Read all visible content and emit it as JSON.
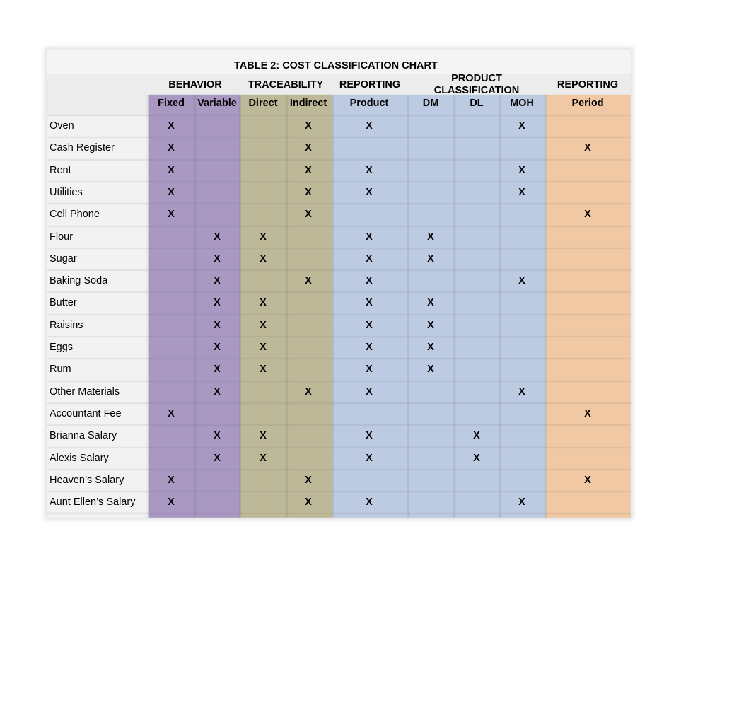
{
  "title": "TABLE 2:  COST CLASSIFICATION CHART",
  "groups": {
    "behavior": "BEHAVIOR",
    "traceability": "TRACEABILITY",
    "reporting_product": "REPORTING",
    "product_classification_line1": "PRODUCT",
    "product_classification_line2": "CLASSIFICATION",
    "reporting_period": "REPORTING"
  },
  "columns": [
    "Fixed",
    "Variable",
    "Direct",
    "Indirect",
    "Product",
    "DM",
    "DL",
    "MOH",
    "Period"
  ],
  "mark_symbol": "X",
  "colors": {
    "behavior": "#a898c2",
    "traceability": "#bdb898",
    "product": "#bccbe2",
    "period": "#f0c8a4"
  },
  "rows": [
    {
      "item": "Oven",
      "marks": [
        "Fixed",
        "Indirect",
        "Product",
        "MOH"
      ]
    },
    {
      "item": "Cash Register",
      "marks": [
        "Fixed",
        "Indirect",
        "Period"
      ]
    },
    {
      "item": "Rent",
      "marks": [
        "Fixed",
        "Indirect",
        "Product",
        "MOH"
      ]
    },
    {
      "item": "Utilities",
      "marks": [
        "Fixed",
        "Indirect",
        "Product",
        "MOH"
      ]
    },
    {
      "item": "Cell Phone",
      "marks": [
        "Fixed",
        "Indirect",
        "Period"
      ]
    },
    {
      "item": "Flour",
      "marks": [
        "Variable",
        "Direct",
        "Product",
        "DM"
      ]
    },
    {
      "item": "Sugar",
      "marks": [
        "Variable",
        "Direct",
        "Product",
        "DM"
      ]
    },
    {
      "item": "Baking Soda",
      "marks": [
        "Variable",
        "Indirect",
        "Product",
        "MOH"
      ]
    },
    {
      "item": "Butter",
      "marks": [
        "Variable",
        "Direct",
        "Product",
        "DM"
      ]
    },
    {
      "item": "Raisins",
      "marks": [
        "Variable",
        "Direct",
        "Product",
        "DM"
      ]
    },
    {
      "item": "Eggs",
      "marks": [
        "Variable",
        "Direct",
        "Product",
        "DM"
      ]
    },
    {
      "item": "Rum",
      "marks": [
        "Variable",
        "Direct",
        "Product",
        "DM"
      ]
    },
    {
      "item": "Other Materials",
      "marks": [
        "Variable",
        "Indirect",
        "Product",
        "MOH"
      ]
    },
    {
      "item": "Accountant Fee",
      "marks": [
        "Fixed",
        "Period"
      ]
    },
    {
      "item": "Brianna Salary",
      "marks": [
        "Variable",
        "Direct",
        "Product",
        "DL"
      ]
    },
    {
      "item": "Alexis Salary",
      "marks": [
        "Variable",
        "Direct",
        "Product",
        "DL"
      ]
    },
    {
      "item": "Heaven’s Salary",
      "marks": [
        "Fixed",
        "Indirect",
        "Period"
      ]
    },
    {
      "item": "Aunt Ellen’s Salary",
      "marks": [
        "Fixed",
        "Indirect",
        "Product",
        "MOH"
      ]
    }
  ]
}
